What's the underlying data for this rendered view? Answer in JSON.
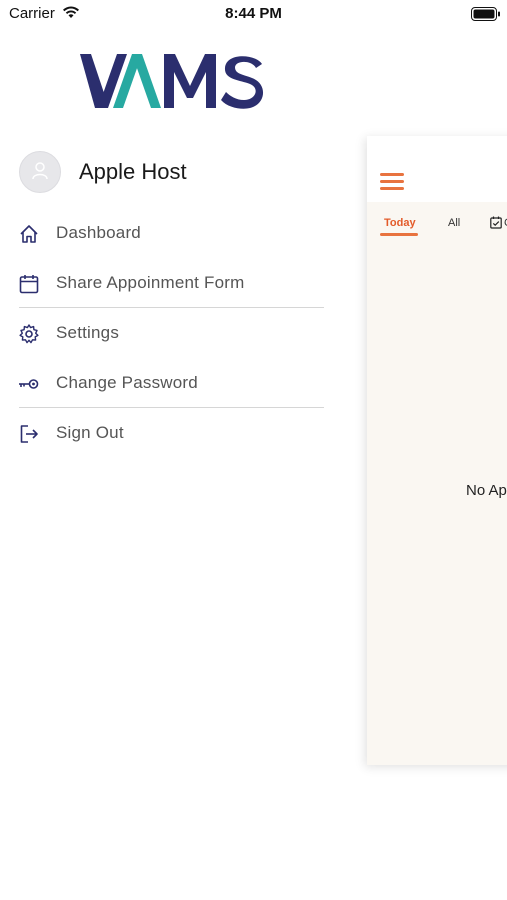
{
  "status_bar": {
    "carrier": "Carrier",
    "time": "8:44 PM"
  },
  "logo": {
    "text": "VAMS",
    "colors": {
      "navy": "#2b2e6e",
      "teal": "#27a9a1"
    }
  },
  "profile": {
    "name": "Apple Host"
  },
  "menu": {
    "items": [
      {
        "label": "Dashboard",
        "icon": "home-icon"
      },
      {
        "label": "Share Appoinment Form",
        "icon": "calendar-icon"
      },
      {
        "label": "Settings",
        "icon": "gear-icon"
      },
      {
        "label": "Change Password",
        "icon": "key-icon"
      },
      {
        "label": "Sign Out",
        "icon": "sign-out-icon"
      }
    ]
  },
  "main": {
    "tabs": [
      {
        "label": "Today",
        "active": true
      },
      {
        "label": "All"
      },
      {
        "label": "C"
      }
    ],
    "empty_text": "No Ap"
  },
  "colors": {
    "accent": "#e8733f",
    "icon": "#2b2e6e",
    "menu_text": "#555555"
  }
}
